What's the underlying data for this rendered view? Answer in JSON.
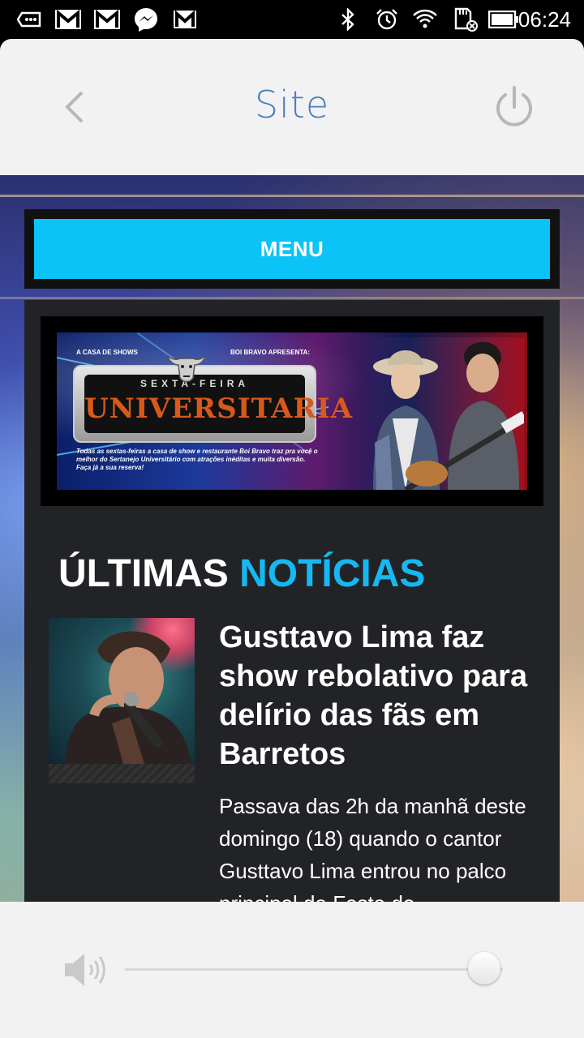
{
  "status_bar": {
    "time": "06:24",
    "left_icons": [
      "voicemail-icon",
      "gmail-icon",
      "gmail-icon",
      "messenger-icon",
      "gmail-icon"
    ],
    "right_icons": [
      "bluetooth-icon",
      "alarm-icon",
      "wifi-icon",
      "sd-card-icon",
      "battery-icon"
    ]
  },
  "header": {
    "title": "Site",
    "back_icon": "chevron-left-icon",
    "power_icon": "power-icon"
  },
  "page": {
    "menu_label": "MENU",
    "banner": {
      "left_caption": "A CASA DE SHOWS",
      "right_caption": "BOI BRAVO APRESENTA:",
      "subtitle": "SEXTA-FEIRA",
      "title": "UNIVERSITARIA",
      "description": "Todas as sextas-feiras a casa de show e restaurante Boi Bravo traz pra você o melhor do Sertanejo Universitário com atrações inéditas e muita diversão. Faça já a sua reserva!"
    },
    "news_heading": {
      "part1": "ÚLTIMAS",
      "part2": "NOTÍCIAS"
    },
    "news_item": {
      "title": "Gusttavo Lima faz show rebolativo para delírio das fãs em Barretos",
      "excerpt": "Passava das 2h da manhã deste domingo (18) quando o cantor Gusttavo Lima entrou no palco principal da Festa do"
    }
  },
  "volume": {
    "icon": "speaker-icon",
    "level": 0.95
  },
  "colors": {
    "accent": "#0bc3f7",
    "heading_accent": "#17b8f2",
    "title_blue": "#4a7fbf"
  }
}
